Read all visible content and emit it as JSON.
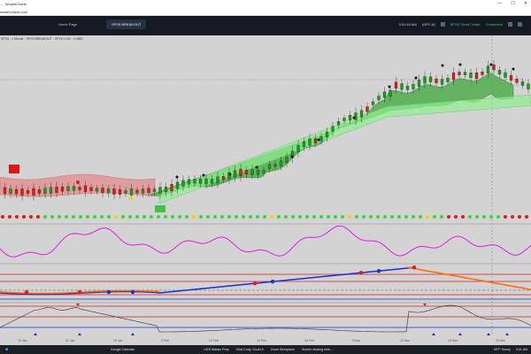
{
  "browser": {
    "tab_title": "...- WealthCharts",
    "url": "wealthcharts.com",
    "controls": [
      "—",
      "☐",
      "✕"
    ]
  },
  "app": {
    "tabs": [
      {
        "label": "Home Page"
      },
      {
        "label": "SPX5 BREAKOUT"
      }
    ],
    "clock": "3:01:40 AM",
    "zone": "(GPC-6)",
    "feed_label": "SPX5 Trend Finder",
    "status": "Connected"
  },
  "chart": {
    "header": "SPX5 - 1 Minute · SPX5 BREAKOUT · SPX5 1.0% · 0.4880",
    "colors": {
      "background": "#d3d3d3",
      "up": "#1a9e1a",
      "down": "#d81e1e",
      "cloud_green": "#3ea83e",
      "cloud_red": "#e07a7a",
      "oscillator": "#e11be6",
      "trend_blue": "#1a2fc8",
      "trend_orange": "#ff6a00"
    },
    "x_labels": [
      "15 Jan",
      "22 Jan",
      "29 Jan",
      "5 Feb",
      "12 Feb",
      "19 Feb",
      "26 Feb",
      "5 Mar",
      "12 Mar",
      "19 Mar",
      "26 Mar"
    ]
  },
  "taskbar": {
    "items": [
      {
        "label": "Google Calendar"
      },
      {
        "label": "UGS Master Prep"
      },
      {
        "label": "Chat Cody, South A"
      },
      {
        "label": "Zoom Workplace"
      },
      {
        "label": "Screen sharing mee..."
      }
    ],
    "weather": "59°F Sunny",
    "time": "3:01 AM"
  }
}
